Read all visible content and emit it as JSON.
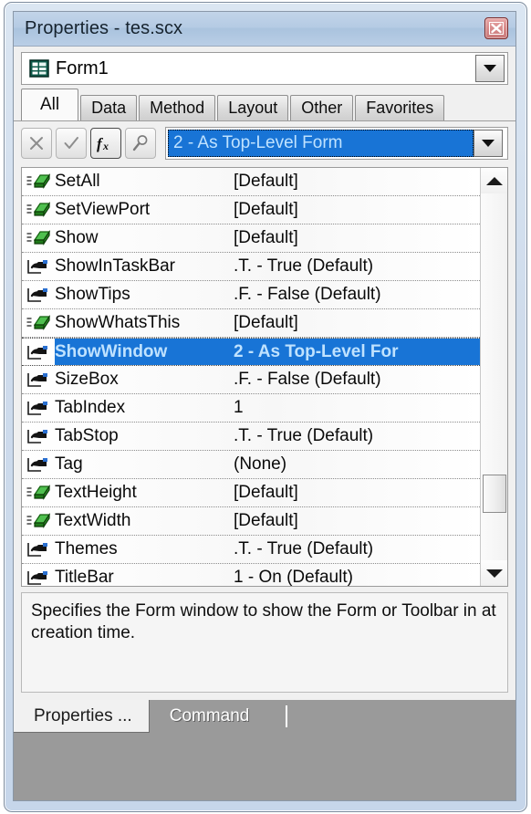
{
  "window": {
    "title": "Properties - tes.scx",
    "close_icon": "close-x-icon"
  },
  "object_combo": {
    "icon": "form-grid-icon",
    "value": "Form1",
    "dropdown_icon": "chevron-down-icon"
  },
  "tabs": [
    {
      "label": "All",
      "active": true
    },
    {
      "label": "Data",
      "active": false
    },
    {
      "label": "Method",
      "active": false
    },
    {
      "label": "Layout",
      "active": false
    },
    {
      "label": "Other",
      "active": false
    },
    {
      "label": "Favorites",
      "active": false
    }
  ],
  "edit_toolbar": {
    "buttons": [
      {
        "name": "cancel-edit-button",
        "icon": "x-icon",
        "label": "✕",
        "pressed": false
      },
      {
        "name": "accept-edit-button",
        "icon": "check-icon",
        "label": "✓",
        "pressed": false
      },
      {
        "name": "function-button",
        "icon": "fx-icon",
        "label": "fx",
        "pressed": true
      },
      {
        "name": "zoom-button",
        "icon": "magnifier-icon",
        "label": "⌕",
        "pressed": false
      }
    ],
    "value": "2 - As Top-Level Form",
    "dropdown_icon": "chevron-down-icon"
  },
  "property_list": {
    "rows": [
      {
        "icon": "method-icon",
        "name": "SetAll",
        "value": "[Default]",
        "selected": false
      },
      {
        "icon": "method-icon",
        "name": "SetViewPort",
        "value": "[Default]",
        "selected": false
      },
      {
        "icon": "method-icon",
        "name": "Show",
        "value": "[Default]",
        "selected": false
      },
      {
        "icon": "property-icon",
        "name": "ShowInTaskBar",
        "value": ".T. - True (Default)",
        "selected": false
      },
      {
        "icon": "property-icon",
        "name": "ShowTips",
        "value": ".F. - False (Default)",
        "selected": false
      },
      {
        "icon": "method-icon",
        "name": "ShowWhatsThis",
        "value": "[Default]",
        "selected": false
      },
      {
        "icon": "property-icon",
        "name": "ShowWindow",
        "value": "2 - As Top-Level For",
        "selected": true
      },
      {
        "icon": "property-icon",
        "name": "SizeBox",
        "value": ".F. - False (Default)",
        "selected": false
      },
      {
        "icon": "property-icon",
        "name": "TabIndex",
        "value": "1",
        "selected": false
      },
      {
        "icon": "property-icon",
        "name": "TabStop",
        "value": ".T. - True (Default)",
        "selected": false
      },
      {
        "icon": "property-icon",
        "name": "Tag",
        "value": "(None)",
        "selected": false
      },
      {
        "icon": "method-icon",
        "name": "TextHeight",
        "value": "[Default]",
        "selected": false
      },
      {
        "icon": "method-icon",
        "name": "TextWidth",
        "value": "[Default]",
        "selected": false
      },
      {
        "icon": "property-icon",
        "name": "Themes",
        "value": ".T. - True (Default)",
        "selected": false
      },
      {
        "icon": "property-icon",
        "name": "TitleBar",
        "value": "1 - On (Default)",
        "selected": false
      }
    ],
    "scrollbar": {
      "up_icon": "scroll-up-arrow-icon",
      "down_icon": "scroll-down-arrow-icon"
    }
  },
  "description": {
    "text": "Specifies the Form window to show the Form or Toolbar in at creation time."
  },
  "dock_tabs": [
    {
      "label": "Properties ...",
      "active": true
    },
    {
      "label": "Command",
      "active": false
    }
  ],
  "colors": {
    "selection": "#1874d6",
    "selection_text": "#bfe2ff",
    "titlebar": "#b5cbe4",
    "close_button": "#d88c8c",
    "dock_bar": "#9a9a9a"
  }
}
